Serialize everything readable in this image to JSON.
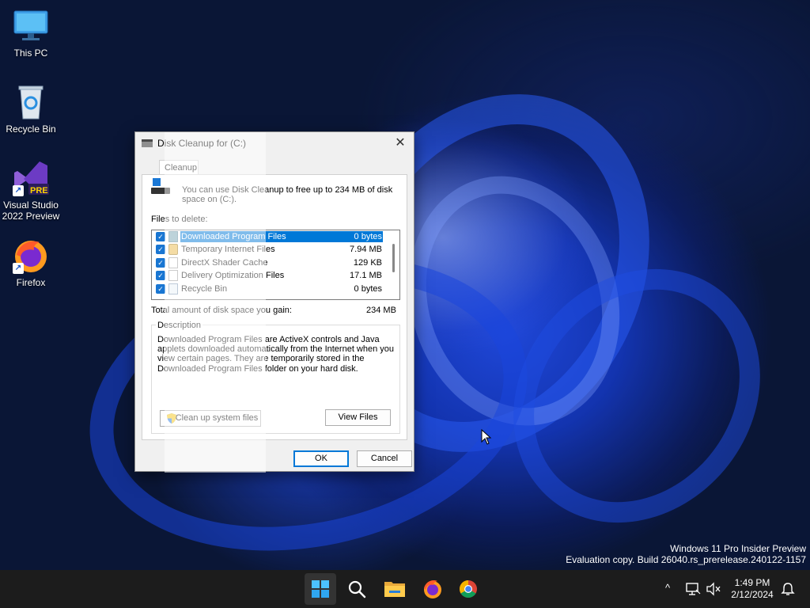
{
  "desktop": {
    "icons": [
      {
        "label": "This PC",
        "icon": "this-pc-icon"
      },
      {
        "label": "Recycle Bin",
        "icon": "recycle-bin-icon"
      },
      {
        "label": "Visual Studio\n2022 Preview",
        "icon": "visual-studio-icon",
        "badge": "PRE"
      },
      {
        "label": "Firefox",
        "icon": "firefox-icon"
      }
    ],
    "watermark": {
      "line1": "Windows 11 Pro Insider Preview",
      "line2": "Evaluation copy. Build 26040.rs_prerelease.240122-1157"
    }
  },
  "dialog": {
    "title": "Disk Cleanup for  (C:)",
    "tab_label": "Cleanup",
    "intro_text": "You can use Disk Cleanup to free up to 234 MB of disk space on  (C:).",
    "files_label": "Files to delete:",
    "files": [
      {
        "name": "Downloaded Program Files",
        "size": "0 bytes",
        "checked": true,
        "selected": true,
        "icon": "folder-icon"
      },
      {
        "name": "Temporary Internet Files",
        "size": "7.94 MB",
        "checked": true,
        "selected": false,
        "icon": "lock-icon"
      },
      {
        "name": "DirectX Shader Cache",
        "size": "129 KB",
        "checked": true,
        "selected": false,
        "icon": "file-icon"
      },
      {
        "name": "Delivery Optimization Files",
        "size": "17.1 MB",
        "checked": true,
        "selected": false,
        "icon": "file-icon"
      },
      {
        "name": "Recycle Bin",
        "size": "0 bytes",
        "checked": true,
        "selected": false,
        "icon": "recycle-bin-icon"
      }
    ],
    "total_label": "Total amount of disk space you gain:",
    "total_value": "234 MB",
    "description_label": "Description",
    "description_text": "Downloaded Program Files are ActiveX controls and Java applets downloaded automatically from the Internet when you view certain pages. They are temporarily stored in the Downloaded Program Files folder on your hard disk.",
    "cleanup_system_button": "Clean up system files",
    "view_files_button": "View Files",
    "ok_button": "OK",
    "cancel_button": "Cancel",
    "close_glyph": "✕"
  },
  "taskbar": {
    "items": [
      "start-icon",
      "search-icon",
      "file-explorer-icon",
      "firefox-icon",
      "chrome-icon"
    ],
    "tray_chevron": "^",
    "time": "1:49 PM",
    "date": "2/12/2024"
  },
  "colors": {
    "accent": "#0078d7",
    "desktop_bg": "#0a1636",
    "taskbar_bg": "#1c1c1c"
  }
}
